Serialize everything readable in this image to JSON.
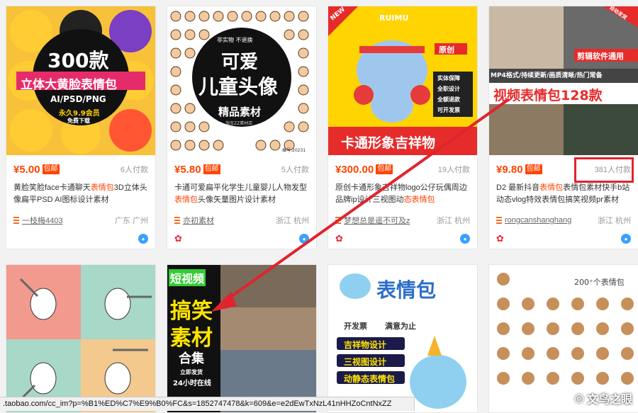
{
  "products": [
    {
      "price": "¥5.00",
      "badge": "包邮",
      "paid": "6人付款",
      "title_pre": "黄脸笑脸face卡通聊天",
      "title_hl": "表情包",
      "title_post": "3D立体头像扁平PSD AI图标设计素材",
      "shop": "一枝梅4403",
      "location": "广东 广州",
      "thumb": {
        "big": "300款",
        "sub": "立体大黄脸表情包",
        "formats": "AI/PSD/PNG",
        "promo": "永久9.9会员",
        "promo_sub": "免费下载"
      }
    },
    {
      "price": "¥5.80",
      "badge": "包邮",
      "paid": "5人付款",
      "title_pre": "卡通可爱扁平化学生儿童婴儿人物发型",
      "title_hl": "表情包",
      "title_post": "头像矢量图片设计素材",
      "shop": "亦初素材",
      "location": "浙江 杭州",
      "thumb": {
        "tags": "非实物  不退换",
        "big1": "可爱",
        "big2": "儿童头像",
        "sub": "精品素材",
        "shop": "淘宝ZZ素材店",
        "code": "编号:20231"
      }
    },
    {
      "price": "¥300.00",
      "badge": "包邮",
      "paid": "19人付款",
      "title_pre": "原创卡通形象吉祥物logo公仔玩偶周边品牌ip设计三视图动",
      "title_hl": "态表情包",
      "title_post": "",
      "shop": "梦想总是遥不可及z",
      "location": "浙江 杭州",
      "thumb": {
        "corner": "NEW",
        "brand": "RUIMU",
        "stamp": "原创",
        "checks": [
          "实体保障",
          "全职设计",
          "全额退款",
          "可开发票"
        ],
        "banner": "卡通形象吉祥物"
      }
    },
    {
      "price": "¥9.80",
      "badge": "包邮",
      "paid": "381人付款",
      "title_pre": "D2 最新抖音",
      "title_hl": "表情包",
      "title_post": "表情包素材快手b站动态vlog特效表情包搞笑视频pr素材",
      "shop": "rongcanshanghang",
      "location": "浙江 杭州",
      "thumb": {
        "corner": "自动发货",
        "edit": "剪辑软件通用",
        "line": "MP4格式/持续更新/画质清晰/热门常备",
        "big": "视频表情包128款"
      }
    },
    {
      "thumb": {}
    },
    {
      "thumb": {
        "l1": "短视频",
        "l2": "搞笑",
        "l3": "素材",
        "l4": "合集",
        "l5": "立即发货",
        "l6": "24小时在线"
      }
    },
    {
      "thumb": {
        "big": "表情包",
        "l1": "开发票",
        "l2": "满意为止",
        "items": [
          "吉祥物设计",
          "三视图设计",
          "动静态表情包"
        ]
      }
    },
    {
      "thumb": {
        "title": "200⁺个表情包"
      }
    }
  ],
  "status_url": ".taobao.com/cc_im?p=%B1%ED%C7%E9%B0%FC&s=1852747478&k=609&e=e2dEwTxNzL41nHHZoCntNxZZ",
  "watermark": "文鸟之眼",
  "icons": {
    "flower": "flower-icon",
    "wangwang": "wangwang-icon"
  },
  "colors": {
    "price": "#ff4400",
    "annotation": "#e0242f"
  }
}
